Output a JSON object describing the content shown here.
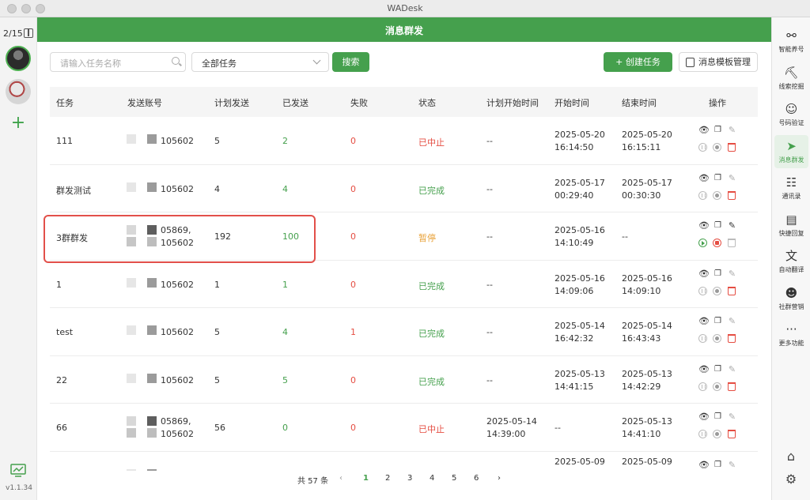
{
  "window": {
    "title": "WADesk"
  },
  "left_sidebar": {
    "counter": "2/15",
    "version": "v1.1.34"
  },
  "header": {
    "title": "消息群发"
  },
  "toolbar": {
    "search_placeholder": "请输入任务名称",
    "filter_selected": "全部任务",
    "search_button": "搜索",
    "create_button": "+ 创建任务",
    "template_button": "消息模板管理"
  },
  "table": {
    "headers": [
      "任务",
      "发送账号",
      "计划发送",
      "已发送",
      "失败",
      "状态",
      "计划开始时间",
      "开始时间",
      "结束时间",
      "操作"
    ],
    "rows": [
      {
        "task": "111",
        "account": "105602",
        "account2": "",
        "planned": "5",
        "sent": "2",
        "failed": "0",
        "status": "已中止",
        "status_color": "red",
        "planned_start": "--",
        "planned_start2": "",
        "start": "2025-05-20",
        "start2": "16:14:50",
        "end": "2025-05-20",
        "end2": "16:15:11"
      },
      {
        "task": "群发测试",
        "account": "105602",
        "account2": "",
        "planned": "4",
        "sent": "4",
        "failed": "0",
        "status": "已完成",
        "status_color": "green",
        "planned_start": "--",
        "planned_start2": "",
        "start": "2025-05-17",
        "start2": "00:29:40",
        "end": "2025-05-17",
        "end2": "00:30:30"
      },
      {
        "task": "3群群发",
        "account": "05869,",
        "account2": "105602",
        "planned": "192",
        "sent": "100",
        "failed": "0",
        "status": "暂停",
        "status_color": "orange",
        "planned_start": "--",
        "planned_start2": "",
        "start": "2025-05-16",
        "start2": "14:10:49",
        "end": "--",
        "end2": ""
      },
      {
        "task": "1",
        "account": "105602",
        "account2": "",
        "planned": "1",
        "sent": "1",
        "failed": "0",
        "status": "已完成",
        "status_color": "green",
        "planned_start": "--",
        "planned_start2": "",
        "start": "2025-05-16",
        "start2": "14:09:06",
        "end": "2025-05-16",
        "end2": "14:09:10"
      },
      {
        "task": "test",
        "account": "105602",
        "account2": "",
        "planned": "5",
        "sent": "4",
        "failed": "1",
        "status": "已完成",
        "status_color": "green",
        "planned_start": "--",
        "planned_start2": "",
        "start": "2025-05-14",
        "start2": "16:42:32",
        "end": "2025-05-14",
        "end2": "16:43:43"
      },
      {
        "task": "22",
        "account": "105602",
        "account2": "",
        "planned": "5",
        "sent": "5",
        "failed": "0",
        "status": "已完成",
        "status_color": "green",
        "planned_start": "--",
        "planned_start2": "",
        "start": "2025-05-13",
        "start2": "14:41:15",
        "end": "2025-05-13",
        "end2": "14:42:29"
      },
      {
        "task": "66",
        "account": "05869,",
        "account2": "105602",
        "planned": "56",
        "sent": "0",
        "failed": "0",
        "status": "已中止",
        "status_color": "red",
        "planned_start": "2025-05-14",
        "planned_start2": "14:39:00",
        "start": "--",
        "start2": "",
        "end": "2025-05-13",
        "end2": "14:41:10"
      },
      {
        "task": "",
        "account": "",
        "account2": "",
        "planned": "",
        "sent": "",
        "failed": "",
        "status": "",
        "status_color": "green",
        "planned_start": "",
        "planned_start2": "",
        "start": "2025-05-09",
        "start2": "",
        "end": "2025-05-09",
        "end2": ""
      }
    ]
  },
  "pagination": {
    "total": "共 57 条",
    "pages": [
      "1",
      "2",
      "3",
      "4",
      "5",
      "6"
    ],
    "current": "1"
  },
  "right_sidebar": {
    "items": [
      {
        "label": "智能养号",
        "icon": "share-nodes-icon"
      },
      {
        "label": "线索挖掘",
        "icon": "digger-icon"
      },
      {
        "label": "号码验证",
        "icon": "user-search-icon"
      },
      {
        "label": "消息群发",
        "icon": "paper-plane-icon"
      },
      {
        "label": "通讯录",
        "icon": "contacts-icon"
      },
      {
        "label": "快捷回复",
        "icon": "chat-icon"
      },
      {
        "label": "自动翻译",
        "icon": "translate-icon"
      },
      {
        "label": "社群营销",
        "icon": "group-icon"
      },
      {
        "label": "更多功能",
        "icon": "more-icon"
      }
    ],
    "active": "消息群发"
  },
  "colors": {
    "brand": "#45a04d",
    "danger": "#e54d42",
    "warning": "#e8a23a",
    "highlight_border": "#e2504a"
  }
}
